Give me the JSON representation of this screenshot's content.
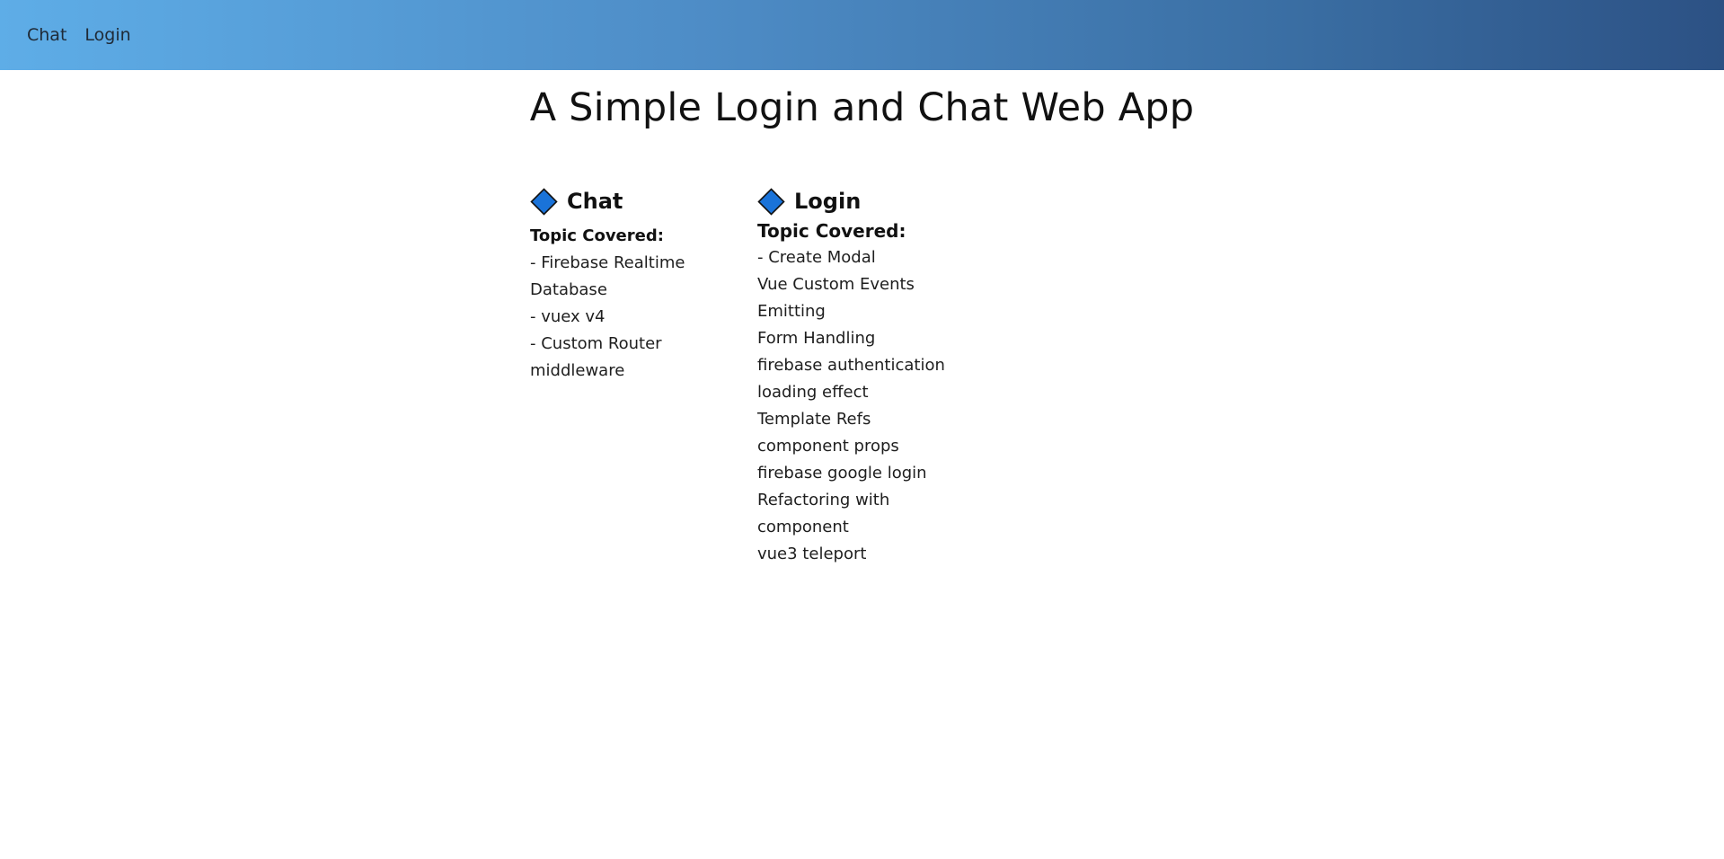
{
  "nav": {
    "links": [
      "Chat",
      "Login"
    ]
  },
  "page": {
    "title": "A Simple Login and Chat Web App"
  },
  "cards": [
    {
      "title": "Chat",
      "icon": "diamond-icon",
      "topic_title": "Topic Covered:",
      "topics": [
        "- Firebase Realtime",
        "Database",
        "- vuex v4",
        "- Custom Router",
        "middleware"
      ]
    },
    {
      "title": "Login",
      "icon": "diamond-icon",
      "topic_title": "Topic Covered:",
      "topics": [
        "- Create Modal",
        "Vue Custom Events",
        "Emitting",
        "Form Handling",
        "firebase authentication",
        "loading effect",
        "Template Refs",
        "component props",
        "firebase google login",
        "Refactoring with",
        "component",
        "vue3 teleport"
      ]
    }
  ],
  "colors": {
    "nav_gradient_start": "#5eade7",
    "nav_gradient_end": "#2c5184",
    "diamond_fill": "#1a73d9"
  }
}
